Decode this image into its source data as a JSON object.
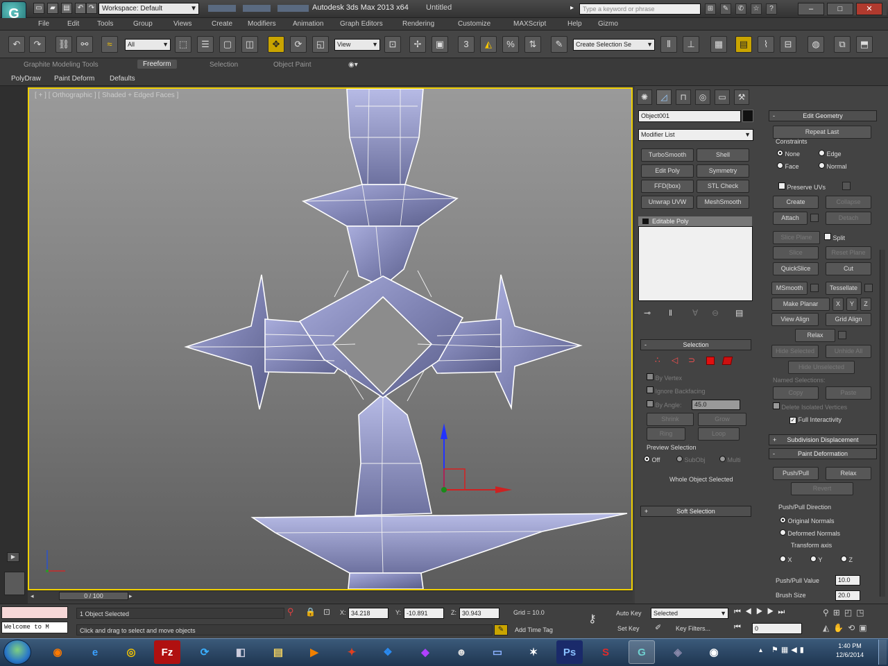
{
  "titlebar": {
    "workspace_label": "Workspace: Default",
    "app_title": "Autodesk 3ds Max 2013 x64",
    "doc_title": "Untitled",
    "help_search_placeholder": "Type a keyword or phrase"
  },
  "menus": [
    "File",
    "Edit",
    "Tools",
    "Group",
    "Views",
    "Create",
    "Modifiers",
    "Animation",
    "Graph Editors",
    "Rendering",
    "Customize",
    "MAXScript",
    "Help",
    "Gizmo"
  ],
  "toolbar": {
    "selection_filter": "All",
    "reference_coord": "View",
    "named_selection_placeholder": "Create Selection Se"
  },
  "ribbon": {
    "tabs": [
      "Graphite Modeling Tools",
      "Freeform",
      "Selection",
      "Object Paint"
    ],
    "active_tab": "Freeform",
    "subtabs": [
      "PolyDraw",
      "Paint Deform",
      "Defaults"
    ]
  },
  "viewport": {
    "label": "[ + ] [ Orthographic ] [ Shaded + Edged Faces ]"
  },
  "command_panel": {
    "object_name": "Object001",
    "object_color": "#111111",
    "modifier_list": "Modifier List",
    "modifier_buttons": [
      "TurboSmooth",
      "Shell",
      "Edit Poly",
      "Symmetry",
      "FFD(box)",
      "STL Check",
      "Unwrap UVW",
      "MeshSmooth"
    ],
    "stack_item": "Editable Poly",
    "edit_geometry": {
      "title": "Edit Geometry",
      "repeat_last": "Repeat Last",
      "constraints_label": "Constraints",
      "radios": [
        "None",
        "Edge",
        "Face",
        "Normal"
      ],
      "preserve_uvs": "Preserve UVs",
      "create": "Create",
      "collapse": "Collapse",
      "attach": "Attach",
      "detach": "Detach",
      "slice_plane": "Slice Plane",
      "split": "Split",
      "slice": "Slice",
      "reset_plane": "Reset Plane",
      "quickslice": "QuickSlice",
      "cut": "Cut",
      "msmooth": "MSmooth",
      "tessellate": "Tessellate",
      "make_planar": "Make Planar",
      "x": "X",
      "y": "Y",
      "z": "Z",
      "view_align": "View Align",
      "grid_align": "Grid Align",
      "relax": "Relax",
      "hide_selected": "Hide Selected",
      "unhide_all": "Unhide All",
      "hide_unselected": "Hide Unselected",
      "named_selections": "Named Selections:",
      "copy": "Copy",
      "paste": "Paste",
      "delete_isolated": "Delete Isolated Vertices",
      "full_interactivity": "Full Interactivity"
    },
    "subdivision_displacement": "Subdivision Displacement",
    "paint_deformation": {
      "title": "Paint Deformation",
      "pushpull": "Push/Pull",
      "relax": "Relax",
      "revert": "Revert",
      "direction_label": "Push/Pull Direction",
      "original_normals": "Original Normals",
      "deformed_normals": "Deformed Normals",
      "transform_axis": "Transform axis",
      "axes": [
        "X",
        "Y",
        "Z"
      ],
      "value_label": "Push/Pull Value",
      "value": "10.0",
      "brush_size_label": "Brush Size",
      "brush_size": "20.0"
    },
    "selection": {
      "title": "Selection",
      "by_vertex": "By Vertex",
      "ignore_backfacing": "Ignore Backfacing",
      "by_angle": "By Angle:",
      "angle_value": "45.0",
      "shrink": "Shrink",
      "grow": "Grow",
      "ring": "Ring",
      "loop": "Loop",
      "preview_label": "Preview Selection",
      "preview_opts": [
        "Off",
        "SubObj",
        "Multi"
      ],
      "whole_object": "Whole Object Selected"
    },
    "soft_selection": "Soft Selection"
  },
  "timeline": {
    "frame": "0 / 100"
  },
  "status": {
    "selected": "1 Object Selected",
    "prompt": "Click and drag to select and move objects",
    "x_label": "X:",
    "x": "34.218",
    "y_label": "Y:",
    "y": "-10.891",
    "z_label": "Z:",
    "z": "30.943",
    "grid": "Grid = 10.0",
    "auto_key": "Auto Key",
    "set_key": "Set Key",
    "key_mode": "Selected",
    "key_filters": "Key Filters...",
    "add_time_tag": "Add Time Tag",
    "current_frame": "0",
    "listener": "Welcome to M"
  },
  "taskbar": {
    "time": "1:40 PM",
    "date": "12/6/2014"
  }
}
